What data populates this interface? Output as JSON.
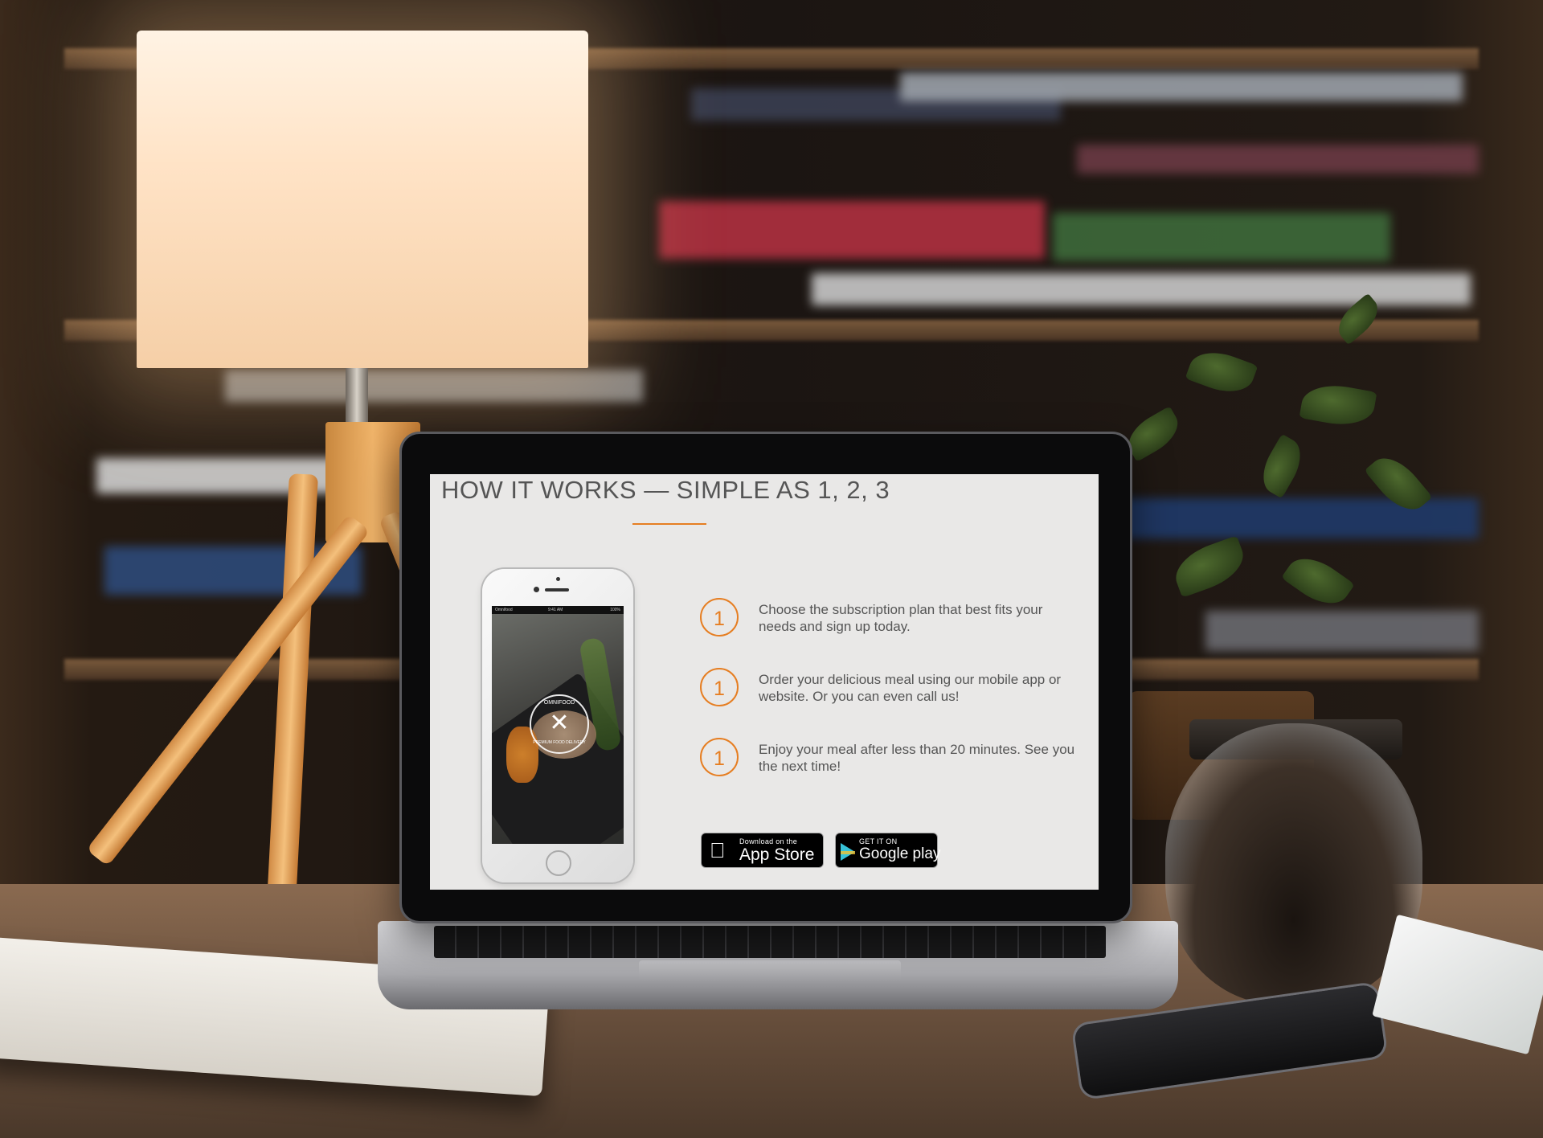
{
  "section": {
    "title": "HOW IT WORKS — SIMPLE AS 1, 2, 3"
  },
  "phone_mockup": {
    "status_carrier": "Omnifood",
    "status_time": "9:41 AM",
    "status_battery": "100%",
    "logo_top": "OMNIFOOD",
    "logo_icon": "fork-knife-icon",
    "logo_bottom": "PREMIUM FOOD DELIVERY"
  },
  "steps": [
    {
      "number": "1",
      "text": "Choose the subscription plan that best fits your needs and sign up today."
    },
    {
      "number": "1",
      "text": "Order your delicious meal using our mobile app or website. Or you can even call us!"
    },
    {
      "number": "1",
      "text": "Enjoy your meal after less than 20 minutes. See you the next time!"
    }
  ],
  "badges": {
    "app_store": {
      "small": "Download on the",
      "big": "App Store",
      "icon": "apple-icon"
    },
    "google_play": {
      "small": "GET IT ON",
      "big": "Google play",
      "icon": "google-play-icon"
    }
  },
  "colors": {
    "accent": "#e67e22",
    "screen_background": "#e9e8e7",
    "text": "#555555",
    "badge_background": "#000000"
  }
}
